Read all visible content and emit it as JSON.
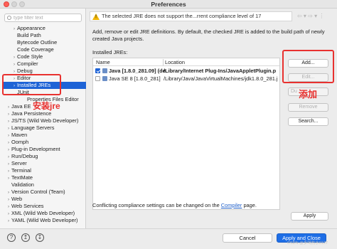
{
  "window": {
    "title": "Preferences"
  },
  "filter": {
    "placeholder": "type filter text"
  },
  "tree": {
    "items": [
      {
        "label": "Appearance",
        "arrow": "›"
      },
      {
        "label": "Build Path",
        "arrow": ""
      },
      {
        "label": "Bytecode Outline",
        "arrow": ""
      },
      {
        "label": "Code Coverage",
        "arrow": ""
      },
      {
        "label": "Code Style",
        "arrow": "›"
      },
      {
        "label": "Compiler",
        "arrow": "›"
      },
      {
        "label": "Debug",
        "arrow": "›"
      },
      {
        "label": "Editor",
        "arrow": "›"
      },
      {
        "label": "Installed JREs",
        "arrow": "›"
      },
      {
        "label": "JUnit",
        "arrow": ""
      },
      {
        "label": "Properties Files Editor",
        "arrow": ""
      },
      {
        "label": "Java EE",
        "arrow": "›"
      },
      {
        "label": "Java Persistence",
        "arrow": "›"
      },
      {
        "label": "JS/TS (Wild Web Developer)",
        "arrow": "›"
      },
      {
        "label": "Language Servers",
        "arrow": "›"
      },
      {
        "label": "Maven",
        "arrow": "›"
      },
      {
        "label": "Oomph",
        "arrow": "›"
      },
      {
        "label": "Plug-in Development",
        "arrow": "›"
      },
      {
        "label": "Run/Debug",
        "arrow": "›"
      },
      {
        "label": "Server",
        "arrow": "›"
      },
      {
        "label": "Terminal",
        "arrow": "›"
      },
      {
        "label": "TextMate",
        "arrow": "›"
      },
      {
        "label": "Validation",
        "arrow": ""
      },
      {
        "label": "Version Control (Team)",
        "arrow": "›"
      },
      {
        "label": "Web",
        "arrow": "›"
      },
      {
        "label": "Web Services",
        "arrow": "›"
      },
      {
        "label": "XML (Wild Web Developer)",
        "arrow": "›"
      },
      {
        "label": "YAML (Wild Web Developer)",
        "arrow": "›"
      }
    ]
  },
  "annotations": {
    "install_jre": "安装jre",
    "add": "添加"
  },
  "right": {
    "message": "The selected JRE does not support the...rrent compliance level of 17",
    "nav": "⇦ ▾ ⇨ ▾ ⋮",
    "description": "Add, remove or edit JRE definitions. By default, the checked JRE is added to the build path of newly created Java projects.",
    "jres_label": "Installed JREs:",
    "columns": {
      "name": "Name",
      "location": "Location"
    },
    "rows": [
      {
        "name": "Java [1.8.0_281.09] (de",
        "location": "/Library/Internet Plug-Ins/JavaAppletPlugin.p",
        "checked": true,
        "bold": true
      },
      {
        "name": "Java SE 8 [1.8.0_281]",
        "location": "/Library/Java/JavaVirtualMachines/jdk1.8.0_281.j",
        "checked": false,
        "bold": false
      }
    ],
    "buttons": {
      "add": "Add...",
      "edit": "Edit...",
      "duplicate": "Du",
      "remove": "Remove",
      "search": "Search..."
    },
    "conflict_text": "Conflicting compliance settings can be changed on the",
    "conflict_link": "Compiler",
    "conflict_suffix": "page.",
    "apply": "Apply"
  },
  "bottom": {
    "help_icon": "?",
    "import_icon": "↥",
    "export_icon": "↧",
    "cancel": "Cancel",
    "apply_close": "Apply and Close"
  },
  "watermark": "CSDN @多喝热水0127",
  "colors": {
    "selection": "#1e63d6",
    "primary_button": "#1e6ee6",
    "annotation_red": "#e8312f",
    "warning": "#f0b400"
  }
}
